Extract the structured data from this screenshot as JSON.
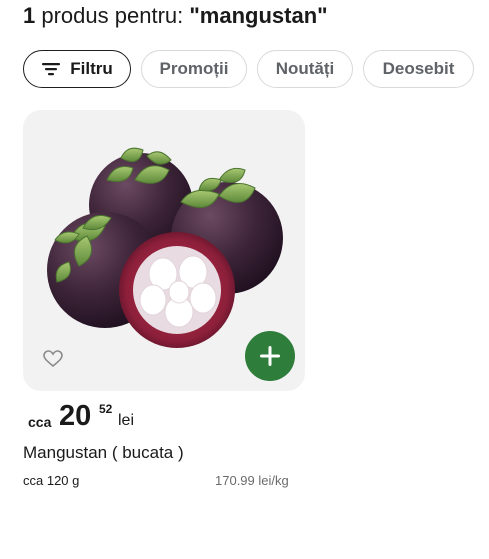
{
  "heading": {
    "count": "1",
    "middle": "produs pentru:",
    "query": "\"mangustan\""
  },
  "filters": {
    "filter_label": "Filtru",
    "chips": [
      "Promoții",
      "Noutăți",
      "Deosebit"
    ]
  },
  "product": {
    "price_prefix": "cca",
    "price_integer": "20",
    "price_decimals": "52",
    "currency": "lei",
    "name": "Mangustan ( bucata )",
    "weight": "cca 120 g",
    "unit_price": "170.99 lei/kg",
    "image": "mangosteen-fruit-photo"
  },
  "icons": {
    "filter": "filter-lines-icon",
    "favorite": "heart-outline-icon",
    "add": "plus-icon"
  },
  "colors": {
    "add_button": "#2e7d3a",
    "card_bg": "#f2f2f2",
    "chip_border": "#d9d9d9"
  }
}
